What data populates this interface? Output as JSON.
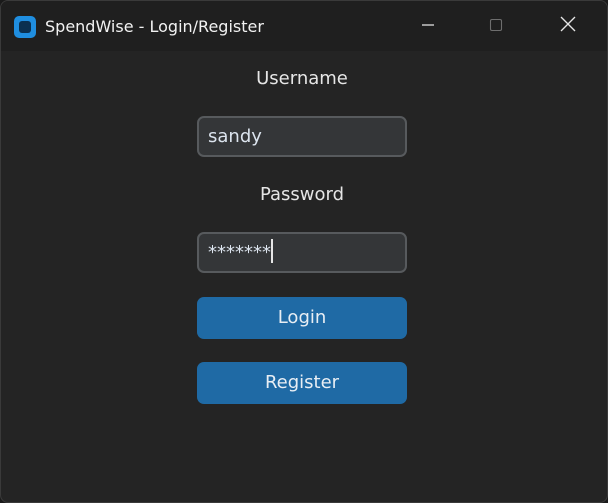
{
  "window": {
    "title": "SpendWise - Login/Register",
    "app_icon": "spendwise-app-icon",
    "controls": {
      "minimize_icon": "minimize-icon",
      "maximize_icon": "maximize-icon",
      "close_icon": "close-icon"
    }
  },
  "form": {
    "username_label": "Username",
    "username_value": "sandy",
    "password_label": "Password",
    "password_value": "*******",
    "login_label": "Login",
    "register_label": "Register"
  },
  "colors": {
    "window_bg": "#242424",
    "titlebar_bg": "#1f1f1f",
    "input_bg": "#343638",
    "input_border": "#575a5d",
    "button_bg": "#1f6aa5",
    "accent_icon": "#1f8ee0"
  }
}
